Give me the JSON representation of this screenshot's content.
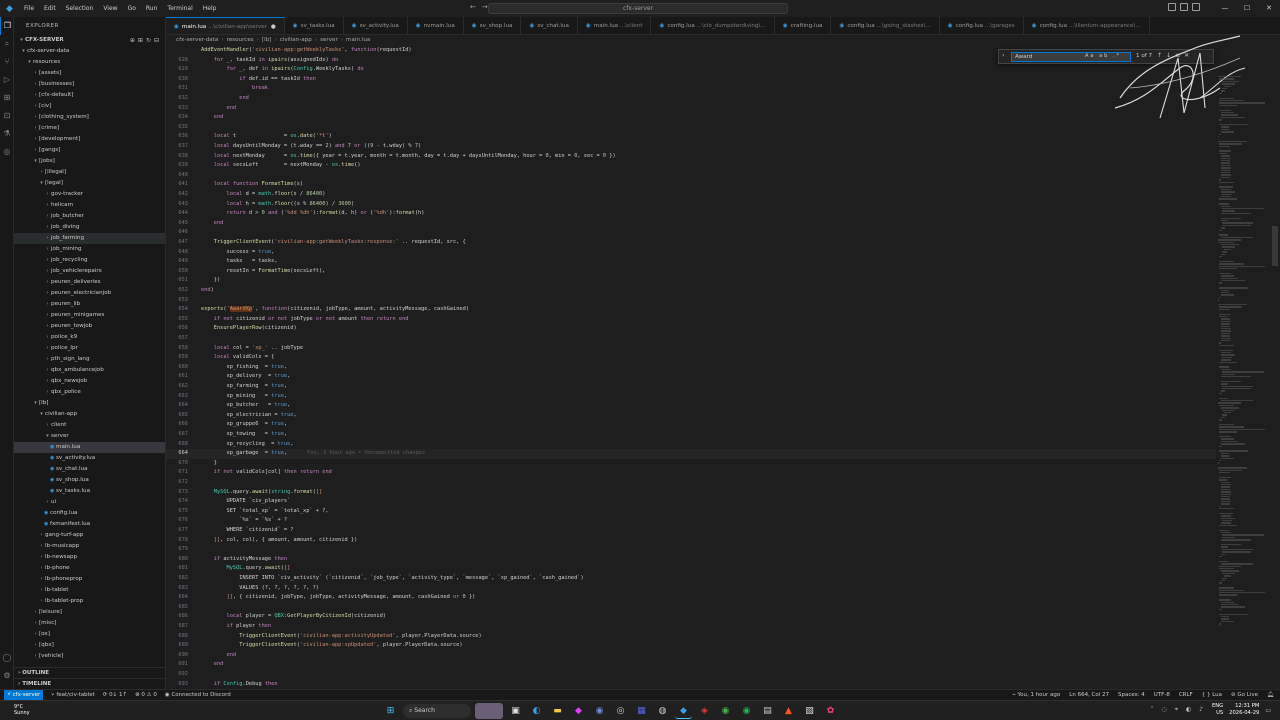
{
  "titlebar": {
    "menu": [
      "File",
      "Edit",
      "Selection",
      "View",
      "Go",
      "Run",
      "Terminal",
      "Help"
    ],
    "command_center": "cfx-server"
  },
  "sidebar": {
    "title": "EXPLORER",
    "root": "CFX-SERVER",
    "tree": [
      {
        "label": "cfx-server-data",
        "depth": 0,
        "type": "folder",
        "open": true
      },
      {
        "label": "resources",
        "depth": 1,
        "type": "folder",
        "open": true
      },
      {
        "label": "[assets]",
        "depth": 2,
        "type": "folder"
      },
      {
        "label": "[businesses]",
        "depth": 2,
        "type": "folder"
      },
      {
        "label": "[cfx-default]",
        "depth": 2,
        "type": "folder"
      },
      {
        "label": "[civ]",
        "depth": 2,
        "type": "folder"
      },
      {
        "label": "[clothing_system]",
        "depth": 2,
        "type": "folder"
      },
      {
        "label": "[crime]",
        "depth": 2,
        "type": "folder"
      },
      {
        "label": "[development]",
        "depth": 2,
        "type": "folder"
      },
      {
        "label": "[gangs]",
        "depth": 2,
        "type": "folder"
      },
      {
        "label": "[jobs]",
        "depth": 2,
        "type": "folder",
        "open": true
      },
      {
        "label": "[illegal]",
        "depth": 3,
        "type": "folder"
      },
      {
        "label": "[legal]",
        "depth": 3,
        "type": "folder",
        "open": true
      },
      {
        "label": "gov-tracker",
        "depth": 4,
        "type": "folder"
      },
      {
        "label": "helicam",
        "depth": 4,
        "type": "folder"
      },
      {
        "label": "job_butcher",
        "depth": 4,
        "type": "folder"
      },
      {
        "label": "job_diving",
        "depth": 4,
        "type": "folder"
      },
      {
        "label": "job_farming",
        "depth": 4,
        "type": "folder",
        "hover": true
      },
      {
        "label": "job_mining",
        "depth": 4,
        "type": "folder"
      },
      {
        "label": "job_recycling",
        "depth": 4,
        "type": "folder"
      },
      {
        "label": "job_vehiclerepairs",
        "depth": 4,
        "type": "folder"
      },
      {
        "label": "peuren_deliveries",
        "depth": 4,
        "type": "folder"
      },
      {
        "label": "peuren_electricianjob",
        "depth": 4,
        "type": "folder"
      },
      {
        "label": "peuren_lib",
        "depth": 4,
        "type": "folder"
      },
      {
        "label": "peuren_minigames",
        "depth": 4,
        "type": "folder"
      },
      {
        "label": "peuren_towjob",
        "depth": 4,
        "type": "folder"
      },
      {
        "label": "police_k9",
        "depth": 4,
        "type": "folder"
      },
      {
        "label": "police_lpr",
        "depth": 4,
        "type": "folder"
      },
      {
        "label": "pth_sign_lang",
        "depth": 4,
        "type": "folder"
      },
      {
        "label": "qbx_ambulancejob",
        "depth": 4,
        "type": "folder"
      },
      {
        "label": "qbx_newsjob",
        "depth": 4,
        "type": "folder"
      },
      {
        "label": "qbx_police",
        "depth": 4,
        "type": "folder"
      },
      {
        "label": "[lb]",
        "depth": 2,
        "type": "folder",
        "open": true
      },
      {
        "label": "civilian-app",
        "depth": 3,
        "type": "folder",
        "open": true
      },
      {
        "label": "client",
        "depth": 4,
        "type": "folder"
      },
      {
        "label": "server",
        "depth": 4,
        "type": "folder",
        "open": true
      },
      {
        "label": "main.lua",
        "depth": 5,
        "type": "file",
        "selected": true
      },
      {
        "label": "sv_activity.lua",
        "depth": 5,
        "type": "file"
      },
      {
        "label": "sv_chat.lua",
        "depth": 5,
        "type": "file"
      },
      {
        "label": "sv_shop.lua",
        "depth": 5,
        "type": "file"
      },
      {
        "label": "sv_tasks.lua",
        "depth": 5,
        "type": "file"
      },
      {
        "label": "ui",
        "depth": 4,
        "type": "folder"
      },
      {
        "label": "config.lua",
        "depth": 4,
        "type": "file"
      },
      {
        "label": "fxmanifest.lua",
        "depth": 4,
        "type": "file"
      },
      {
        "label": "gang-turf-app",
        "depth": 3,
        "type": "folder"
      },
      {
        "label": "lb-musicapp",
        "depth": 3,
        "type": "folder"
      },
      {
        "label": "lb-newsapp",
        "depth": 3,
        "type": "folder"
      },
      {
        "label": "lb-phone",
        "depth": 3,
        "type": "folder"
      },
      {
        "label": "lb-phoneprop",
        "depth": 3,
        "type": "folder"
      },
      {
        "label": "lb-tablet",
        "depth": 3,
        "type": "folder"
      },
      {
        "label": "lb-tablet-prop",
        "depth": 3,
        "type": "folder"
      },
      {
        "label": "[leisure]",
        "depth": 2,
        "type": "folder"
      },
      {
        "label": "[misc]",
        "depth": 2,
        "type": "folder"
      },
      {
        "label": "[ox]",
        "depth": 2,
        "type": "folder"
      },
      {
        "label": "[qbx]",
        "depth": 2,
        "type": "folder"
      },
      {
        "label": "[vehicle]",
        "depth": 2,
        "type": "folder"
      }
    ],
    "outline": "OUTLINE",
    "timeline": "TIMELINE"
  },
  "tabs": [
    {
      "name": "main.lua",
      "dir": "...\\civilian-app\\server",
      "active": true,
      "modified": true
    },
    {
      "name": "sv_tasks.lua",
      "dir": ""
    },
    {
      "name": "sv_activity.lua",
      "dir": ""
    },
    {
      "name": "nvmain.lua",
      "dir": ""
    },
    {
      "name": "sv_shop.lua",
      "dir": ""
    },
    {
      "name": "sv_chat.lua",
      "dir": ""
    },
    {
      "name": "main.lua",
      "dir": "...\\client"
    },
    {
      "name": "config.lua",
      "dir": "...\\clo_dumpsterdiving\\..."
    },
    {
      "name": "crafting.lua",
      "dir": ""
    },
    {
      "name": "config.lua",
      "dir": "...\\going_stashes\\..."
    },
    {
      "name": "config.lua",
      "dir": "...\\garages"
    },
    {
      "name": "config.lua",
      "dir": "...\\illenium-appearance\\..."
    }
  ],
  "breadcrumb": [
    "cfx-server-data",
    "resources",
    "[lb]",
    "civilian-app",
    "server",
    "main.lua"
  ],
  "find": {
    "query": "Award",
    "count": "1 of 7"
  },
  "code": [
    {
      "n": "",
      "t": "AddEventHandler('civilian-app:getWeeklyTasks', function(requestId)"
    },
    {
      "n": "628",
      "t": "    for _, taskId in ipairs(assignedIds) do"
    },
    {
      "n": "629",
      "t": "        for _, def in ipairs(Config.WeeklyTasks) do"
    },
    {
      "n": "630",
      "t": "            if def.id == taskId then"
    },
    {
      "n": "631",
      "t": "                break"
    },
    {
      "n": "632",
      "t": "            end"
    },
    {
      "n": "633",
      "t": "        end"
    },
    {
      "n": "634",
      "t": "    end"
    },
    {
      "n": "635",
      "t": ""
    },
    {
      "n": "636",
      "t": "    local t               = os.date('*t')"
    },
    {
      "n": "637",
      "t": "    local daysUntilMonday = (t.wday == 2) and 7 or ((9 - t.wday) % 7)"
    },
    {
      "n": "638",
      "t": "    local nextMonday      = os.time({ year = t.year, month = t.month, day = t.day + daysUntilMonday, hour = 0, min = 0, sec = 0 })"
    },
    {
      "n": "639",
      "t": "    local secsLeft        = nextMonday - os.time()"
    },
    {
      "n": "640",
      "t": ""
    },
    {
      "n": "641",
      "t": "    local function FormatTime(s)"
    },
    {
      "n": "642",
      "t": "        local d = math.floor(s / 86400)"
    },
    {
      "n": "643",
      "t": "        local h = math.floor((s % 86400) / 3600)"
    },
    {
      "n": "644",
      "t": "        return d > 0 and ('%dd %dh'):format(d, h) or ('%dh'):format(h)"
    },
    {
      "n": "645",
      "t": "    end"
    },
    {
      "n": "646",
      "t": ""
    },
    {
      "n": "647",
      "t": "    TriggerClientEvent('civilian-app:getWeeklyTasks:response:' .. requestId, src, {"
    },
    {
      "n": "648",
      "t": "        success = true,"
    },
    {
      "n": "649",
      "t": "        tasks   = tasks,"
    },
    {
      "n": "650",
      "t": "        resetIn = FormatTime(secsLeft),"
    },
    {
      "n": "651",
      "t": "    })"
    },
    {
      "n": "652",
      "t": "end)"
    },
    {
      "n": "653",
      "t": ""
    },
    {
      "n": "654",
      "t": "exports('AwardXp', function(citizenid, jobType, amount, activityMessage, cashGained)"
    },
    {
      "n": "655",
      "t": "    if not citizenid or not jobType or not amount then return end"
    },
    {
      "n": "656",
      "t": "    EnsurePlayerRow(citizenid)"
    },
    {
      "n": "657",
      "t": ""
    },
    {
      "n": "658",
      "t": "    local col = 'xp_' .. jobType"
    },
    {
      "n": "659",
      "t": "    local validCols = {"
    },
    {
      "n": "660",
      "t": "        xp_fishing  = true,"
    },
    {
      "n": "661",
      "t": "        xp_delivery  = true,"
    },
    {
      "n": "662",
      "t": "        xp_farming  = true,"
    },
    {
      "n": "663",
      "t": "        xp_mining   = true,"
    },
    {
      "n": "664",
      "t": "        xp_butcher   = true,"
    },
    {
      "n": "665",
      "t": "        xp_electrician = true,"
    },
    {
      "n": "666",
      "t": "        xp_gruppe6  = true,"
    },
    {
      "n": "667",
      "t": "        xp_towing   = true,"
    },
    {
      "n": "668",
      "t": "        xp_recycling  = true,"
    },
    {
      "n": "664",
      "t": "        xp_garbage  = true,",
      "current": true,
      "blame": "You, 1 hour ago • Uncommitted changes"
    },
    {
      "n": "670",
      "t": "    }"
    },
    {
      "n": "671",
      "t": "    if not validCols[col] then return end"
    },
    {
      "n": "672",
      "t": ""
    },
    {
      "n": "673",
      "t": "    MySQL.query.await(string.format([["
    },
    {
      "n": "674",
      "t": "        UPDATE `civ_players`"
    },
    {
      "n": "675",
      "t": "        SET `total_xp` = `total_xp` + ?,"
    },
    {
      "n": "676",
      "t": "            `%s` = `%s` + ?"
    },
    {
      "n": "677",
      "t": "        WHERE `citizenid` = ?"
    },
    {
      "n": "678",
      "t": "    ]], col, col), { amount, amount, citizenid })"
    },
    {
      "n": "679",
      "t": ""
    },
    {
      "n": "680",
      "t": "    if activityMessage then"
    },
    {
      "n": "681",
      "t": "        MySQL.query.await([["
    },
    {
      "n": "682",
      "t": "            INSERT INTO `civ_activity` (`citizenid`, `job_type`, `activity_type`, `message`, `xp_gained`, `cash_gained`)"
    },
    {
      "n": "683",
      "t": "            VALUES (?, ?, ?, ?, ?, ?)"
    },
    {
      "n": "684",
      "t": "        ]], { citizenid, jobType, jobType, activityMessage, amount, cashGained or 0 })"
    },
    {
      "n": "685",
      "t": ""
    },
    {
      "n": "686",
      "t": "        local player = QBX:GetPlayerByCitizenId(citizenid)"
    },
    {
      "n": "687",
      "t": "        if player then"
    },
    {
      "n": "688",
      "t": "            TriggerClientEvent('civilian-app:activityUpdated', player.PlayerData.source)"
    },
    {
      "n": "689",
      "t": "            TriggerClientEvent('civilian-app:xpUpdated', player.PlayerData.source)"
    },
    {
      "n": "690",
      "t": "        end"
    },
    {
      "n": "691",
      "t": "    end"
    },
    {
      "n": "692",
      "t": ""
    },
    {
      "n": "693",
      "t": "    if Config.Debug then"
    },
    {
      "n": "694",
      "t": "        print(('[civilian-app] Awarded %d XP (%s) to %s'):format(amount, jobType, citizenid))"
    }
  ],
  "statusbar": {
    "remote": "cfx-server",
    "branch": "feat/civ-tablet",
    "sync": "⟳ 0↓ 1↑",
    "problems": "⊗ 0 ⚠ 0",
    "live_share": "Connected to Discord",
    "blame": "You, 1 hour ago",
    "position": "Ln 664, Col 27",
    "spaces": "Spaces: 4",
    "encoding": "UTF-8",
    "eol": "CRLF",
    "language": "Lua",
    "golive": "Go Live"
  },
  "taskbar": {
    "temp": "9°C",
    "weather": "Sunny",
    "search": "Search",
    "lang": "ENG",
    "region": "US",
    "time": "12:31 PM",
    "date": "2026-04-29"
  },
  "colors": {
    "accent": "#0078d4",
    "editor_bg": "#1e1e1e",
    "sidebar_bg": "#181818",
    "string": "#ce9178",
    "keyword": "#c586c0",
    "function": "#dcdcaa"
  }
}
